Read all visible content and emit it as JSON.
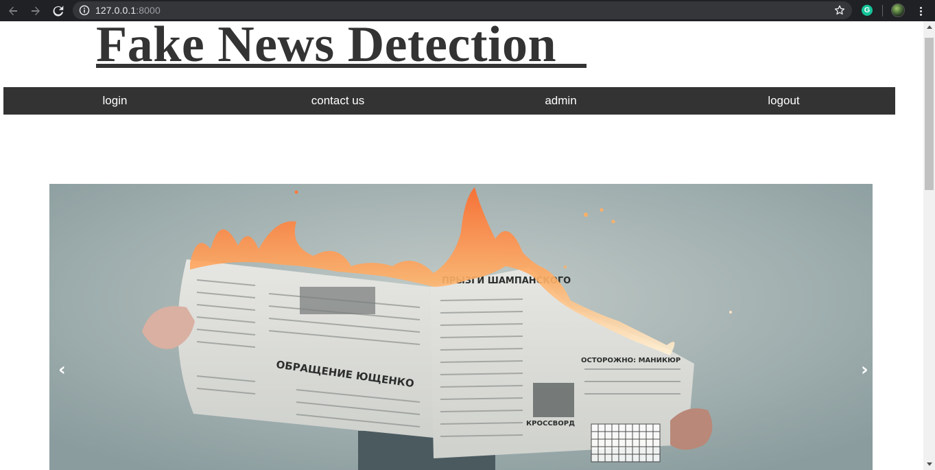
{
  "browser": {
    "url_host": "127.0.0.1",
    "url_port": ":8000",
    "extension_letter": "G"
  },
  "site": {
    "title": "Fake News Detection"
  },
  "nav": {
    "items": [
      {
        "label": "login"
      },
      {
        "label": "contact us"
      },
      {
        "label": "admin"
      },
      {
        "label": "logout"
      }
    ]
  },
  "carousel": {
    "prev_glyph": "‹",
    "next_glyph": "›",
    "image": "burning-newspaper-photo",
    "headline_left": "ОБРАЩЕНИЕ ЮЩЕНКО",
    "masthead": "ПРЫЗГИ ШАМПАНСКОГО",
    "headline_right": "ОСТОРОЖНО: МАНИКЮР",
    "crossword_label": "КРОССВОРД"
  },
  "colors": {
    "chrome_bg": "#202124",
    "navbar_bg": "#333333",
    "title_color": "#333333",
    "flame": "#ff9a3c"
  }
}
